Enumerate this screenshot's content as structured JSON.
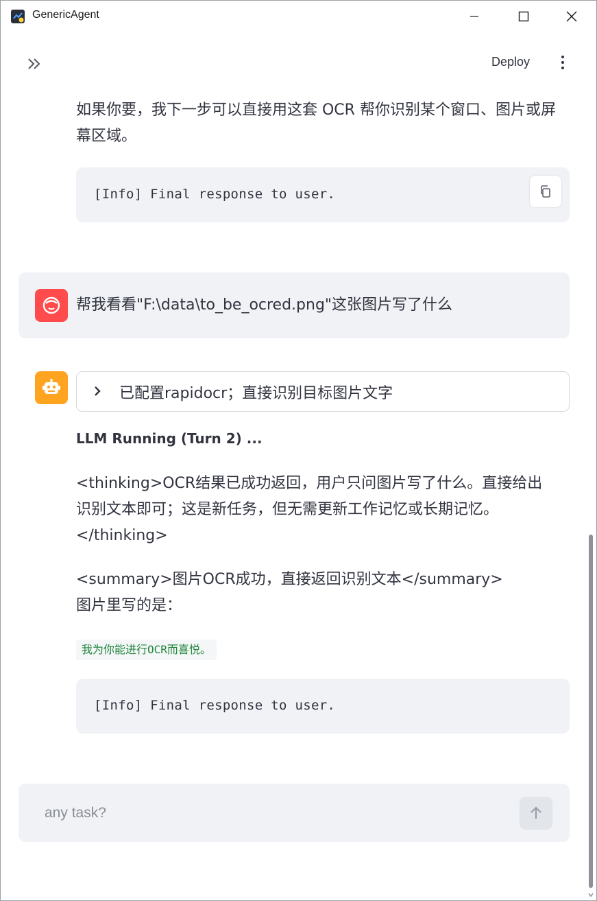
{
  "window": {
    "title": "GenericAgent"
  },
  "toolbar": {
    "deploy_label": "Deploy"
  },
  "messages": {
    "prev_tail": "如果你要，我下一步可以直接用这套 OCR 帮你识别某个窗口、图片或屏幕区域。",
    "code1": "[Info] Final response to user.",
    "user_text": "帮我看看\"F:\\data\\to_be_ocred.png\"这张图片写了什么",
    "expander_label": "已配置rapidocr；直接识别目标图片文字",
    "status": "LLM Running (Turn 2) ...",
    "thinking_line1": "<thinking>OCR结果已成功返回，用户只问图片写了什么。直接给出",
    "thinking_line2": "识别文本即可；这是新任务，但无需更新工作记忆或长期记忆。",
    "thinking_line3": "</thinking>",
    "summary_line": "<summary>图片OCR成功，直接返回识别文本</summary>",
    "answer_intro": "图片里写的是：",
    "ocr_result": "我为你能进行OCR而喜悦。",
    "code2": "[Info] Final response to user."
  },
  "chat_input": {
    "placeholder": "any task?"
  },
  "colors": {
    "user_avatar": "#ff4b4b",
    "bot_avatar": "#ffa421",
    "inline_code": "#21863b",
    "block_bg": "#f0f2f6"
  },
  "icons": {
    "app": "python-icon",
    "sidebar_toggle": "double-chevron-right-icon",
    "menu": "vertical-dots-icon",
    "copy": "copy-icon",
    "user_avatar": "face-icon",
    "bot_avatar": "robot-icon",
    "expander": "chevron-right-icon",
    "send": "arrow-up-icon"
  }
}
